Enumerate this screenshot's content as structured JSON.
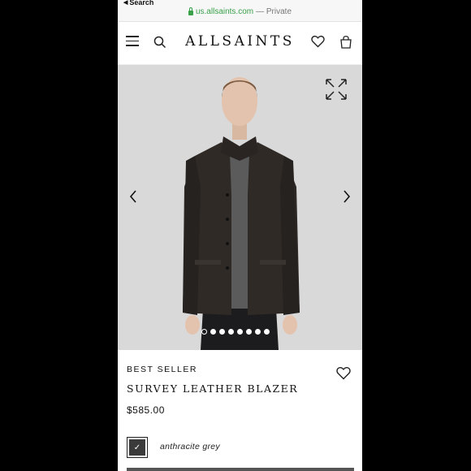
{
  "statusbar": {
    "back_label": "Search",
    "url": "us.allsaints.com",
    "url_suffix": "— Private"
  },
  "header": {
    "logo": "ALLSAINTS"
  },
  "hero": {
    "image_count": 8,
    "active_index": 0
  },
  "product": {
    "badge": "BEST SELLER",
    "name": "SURVEY LEATHER BLAZER",
    "price": "$585.00",
    "color": "anthracite grey",
    "swatch_color": "#3b3b3b",
    "swatch_check": "✓"
  },
  "colors": {
    "hero_bg": "#d6d6d6",
    "jacket": "#2e2925",
    "tshirt": "#5a5a5a"
  }
}
